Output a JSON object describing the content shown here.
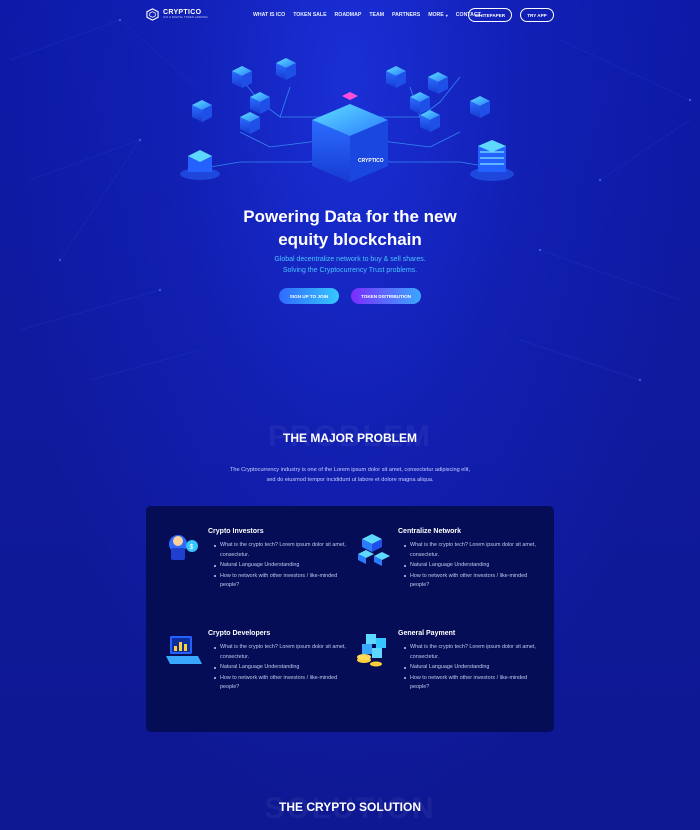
{
  "brand": {
    "name": "CRYPTICO",
    "tagline": "ICO & DIGITAL TOKEN LANDING"
  },
  "nav": {
    "items": [
      {
        "label": "WHAT IS ICO"
      },
      {
        "label": "TOKEN SALE"
      },
      {
        "label": "ROADMAP"
      },
      {
        "label": "TEAM"
      },
      {
        "label": "PARTNERS"
      },
      {
        "label": "MORE"
      },
      {
        "label": "CONTACT"
      }
    ],
    "whitepaper": "WHITEPAPER",
    "try_app": "TRY APP"
  },
  "hero": {
    "title_line1": "Powering Data for the new",
    "title_line2": "equity blockchain",
    "sub_line1": "Global decentralize network to buy & sell shares.",
    "sub_line2": "Solving the Cryptocurrency Trust problems.",
    "signup": "SIGN UP TO JOIN",
    "token": "TOKEN DISTRIBUTION",
    "art_label": "CRYPTICO"
  },
  "problem": {
    "ghost": "PROBLEM",
    "title": "THE MAJOR PROBLEM",
    "desc_line1": "The Cryptocurrency industry is one of the Lorem ipsum dolor sit amet, consectetur adipiscing elit,",
    "desc_line2": "sed do eiusmod tempor incididunt ut labore et dolore magna aliqua.",
    "cards": [
      {
        "title": "Crypto Investors",
        "icon": "investor-icon",
        "items": [
          "What is the crypto tech? Lorem ipsum dolor sit amet, consectetur.",
          "Natural Language Understanding",
          "How to network with other investors / like-minded people?"
        ]
      },
      {
        "title": "Centralize Network",
        "icon": "network-blocks-icon",
        "items": [
          "What is the crypto tech? Lorem ipsum dolor sit amet, consectetur.",
          "Natural Language Understanding",
          "How to network with other investors / like-minded people?"
        ]
      },
      {
        "title": "Crypto Developers",
        "icon": "developer-laptop-icon",
        "items": [
          "What is the crypto tech? Lorem ipsum dolor sit amet, consectetur.",
          "Natural Language Understanding",
          "How to network with other investors / like-minded people?"
        ]
      },
      {
        "title": "General Payment",
        "icon": "payment-coins-icon",
        "items": [
          "What is the crypto tech? Lorem ipsum dolor sit amet, consectetur.",
          "Natural Language Understanding",
          "How to network with other investors / like-minded people?"
        ]
      }
    ]
  },
  "solution": {
    "ghost": "SOLUTION",
    "title": "THE CRYPTO SOLUTION"
  },
  "colors": {
    "background": "#0f1896",
    "panel": "#040d55",
    "accent_cyan": "#36c6ff",
    "accent_purple": "#7b2dff"
  }
}
